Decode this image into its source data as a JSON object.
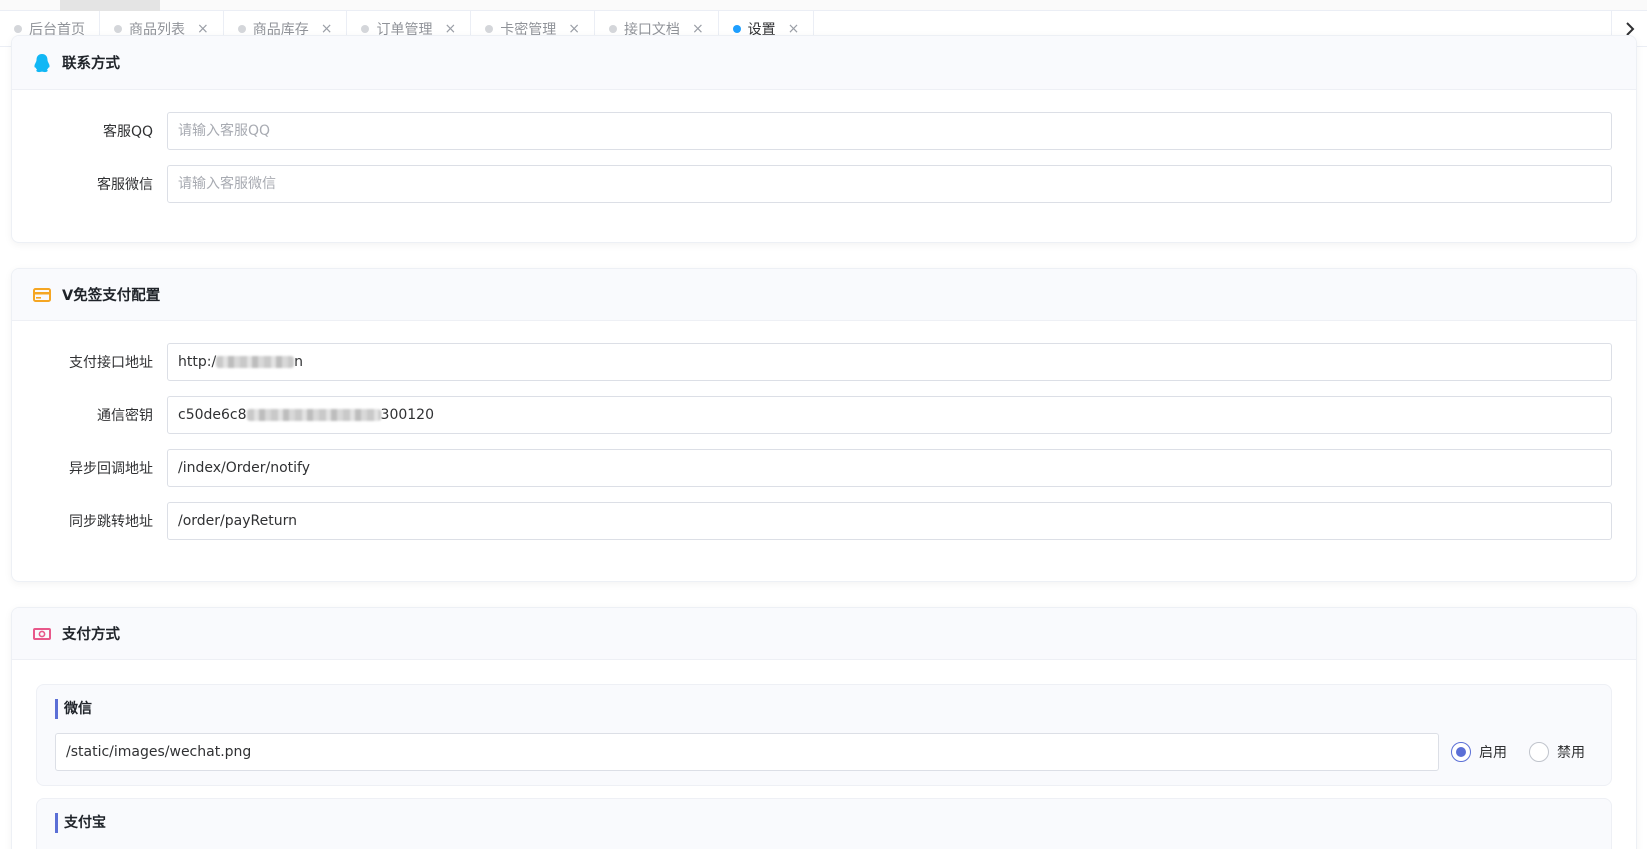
{
  "tabs": [
    {
      "label": "后台首页",
      "closable": false,
      "active": false
    },
    {
      "label": "商品列表",
      "closable": true,
      "active": false
    },
    {
      "label": "商品库存",
      "closable": true,
      "active": false
    },
    {
      "label": "订单管理",
      "closable": true,
      "active": false
    },
    {
      "label": "卡密管理",
      "closable": true,
      "active": false
    },
    {
      "label": "接口文档",
      "closable": true,
      "active": false
    },
    {
      "label": "设置",
      "closable": true,
      "active": true
    }
  ],
  "tab_close_glyph": "×",
  "tab_scroll_icon": "chevron-right-icon",
  "contact": {
    "title": "联系方式",
    "icon": "qq-penguin-icon",
    "qq_label": "客服QQ",
    "qq_placeholder": "请输入客服QQ",
    "qq_value": "",
    "wechat_label": "客服微信",
    "wechat_placeholder": "请输入客服微信",
    "wechat_value": ""
  },
  "vpay": {
    "title": "V免签支付配置",
    "icon": "credit-card-icon",
    "api_label": "支付接口地址",
    "api_value_prefix": "http:/",
    "api_value_suffix": "n",
    "key_label": "通信密钥",
    "key_value_prefix": "c50de6c8",
    "key_value_suffix": "300120",
    "notify_label": "异步回调地址",
    "notify_value": "/index/Order/notify",
    "return_label": "同步跳转地址",
    "return_value": "/order/payReturn"
  },
  "payment": {
    "title": "支付方式",
    "icon": "banknote-icon",
    "methods": [
      {
        "name": "微信",
        "image": "/static/images/wechat.png",
        "enabled": true,
        "enable_label": "启用",
        "disable_label": "禁用"
      },
      {
        "name": "支付宝"
      }
    ]
  },
  "colors": {
    "accent": "#5b6fd6",
    "tab_active_dot": "#1e9fff",
    "qq_icon": "#12b7f5",
    "card_icon": "#f5a623",
    "money_icon": "#e8588a"
  }
}
